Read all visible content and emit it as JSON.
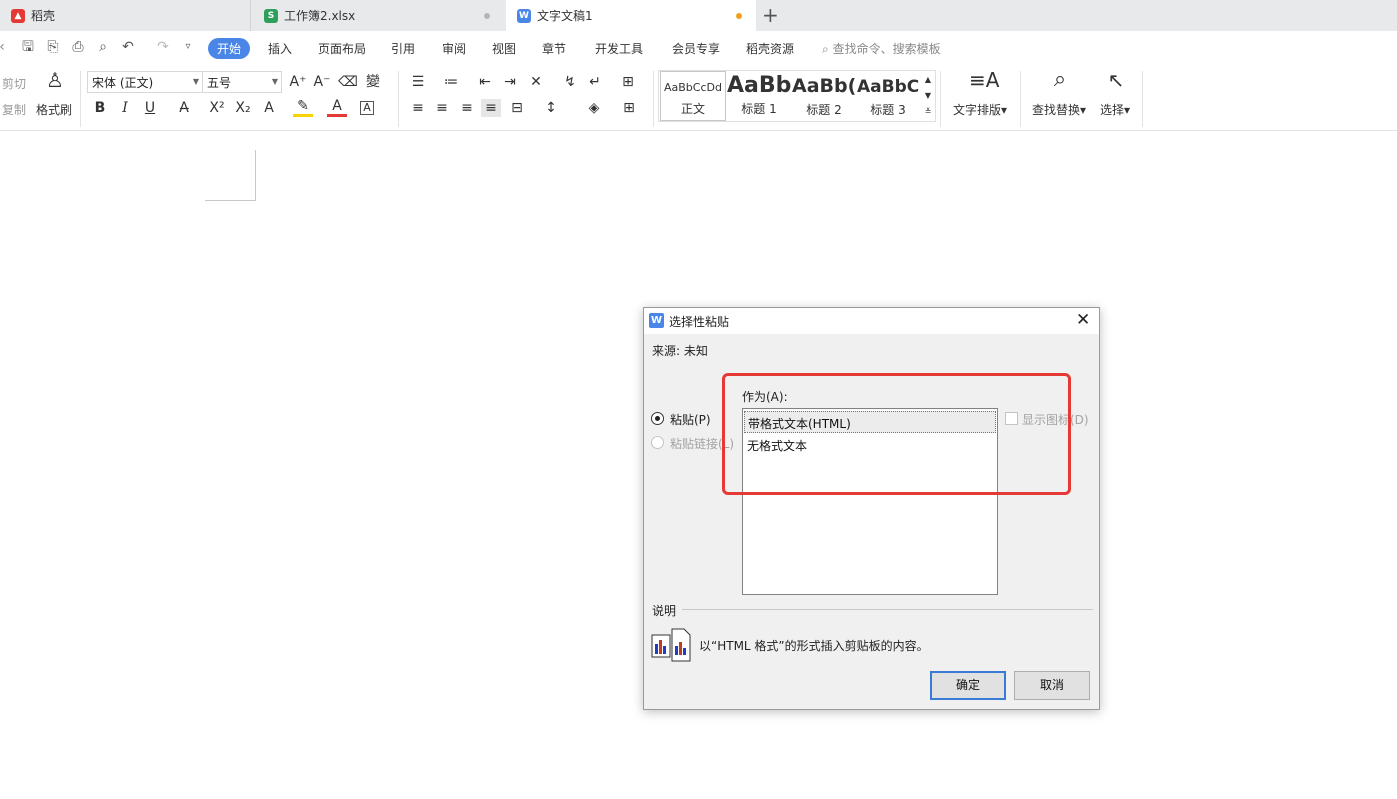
{
  "tabs": [
    {
      "label": "稻壳",
      "icon": "docer-icon",
      "color": "#e53935"
    },
    {
      "label": "工作簿2.xlsx",
      "icon": "spreadsheet-icon",
      "color": "#2e9e5b"
    },
    {
      "label": "文字文稿1",
      "icon": "writer-icon",
      "color": "#4a86e8"
    }
  ],
  "menu": {
    "items": [
      "开始",
      "插入",
      "页面布局",
      "引用",
      "审阅",
      "视图",
      "章节",
      "开发工具",
      "会员专享",
      "稻壳资源"
    ],
    "active": "开始",
    "search_placeholder": "查找命令、搜索模板"
  },
  "ribbon": {
    "cut": "剪切",
    "copy": "复制",
    "format_painter": "格式刷",
    "font_name": "宋体 (正文)",
    "font_size": "五号",
    "styles": [
      {
        "preview": "AaBbCcDd",
        "label": "正文"
      },
      {
        "preview": "AaBb",
        "label": "标题 1"
      },
      {
        "preview": "AaBb(",
        "label": "标题 2"
      },
      {
        "preview": "AaBbC(",
        "label": "标题 3"
      }
    ],
    "text_layout": "文字排版",
    "find_replace": "查找替换",
    "select": "选择"
  },
  "dialog": {
    "title": "选择性粘贴",
    "source": "来源: 未知",
    "as_label": "作为(A):",
    "paste_option": "粘贴(P)",
    "paste_link_option": "粘贴链接(L)",
    "formats": [
      "带格式文本(HTML)",
      "无格式文本"
    ],
    "selected_format": "带格式文本(HTML)",
    "show_icon": "显示图标(D)",
    "description_label": "说明",
    "description_text": "以“HTML 格式”的形式插入剪贴板的内容。",
    "ok": "确定",
    "cancel": "取消"
  },
  "colors": {
    "accent": "#4a86e8",
    "highlight_box": "#e53935",
    "unsaved_dot": "#f0a020"
  }
}
